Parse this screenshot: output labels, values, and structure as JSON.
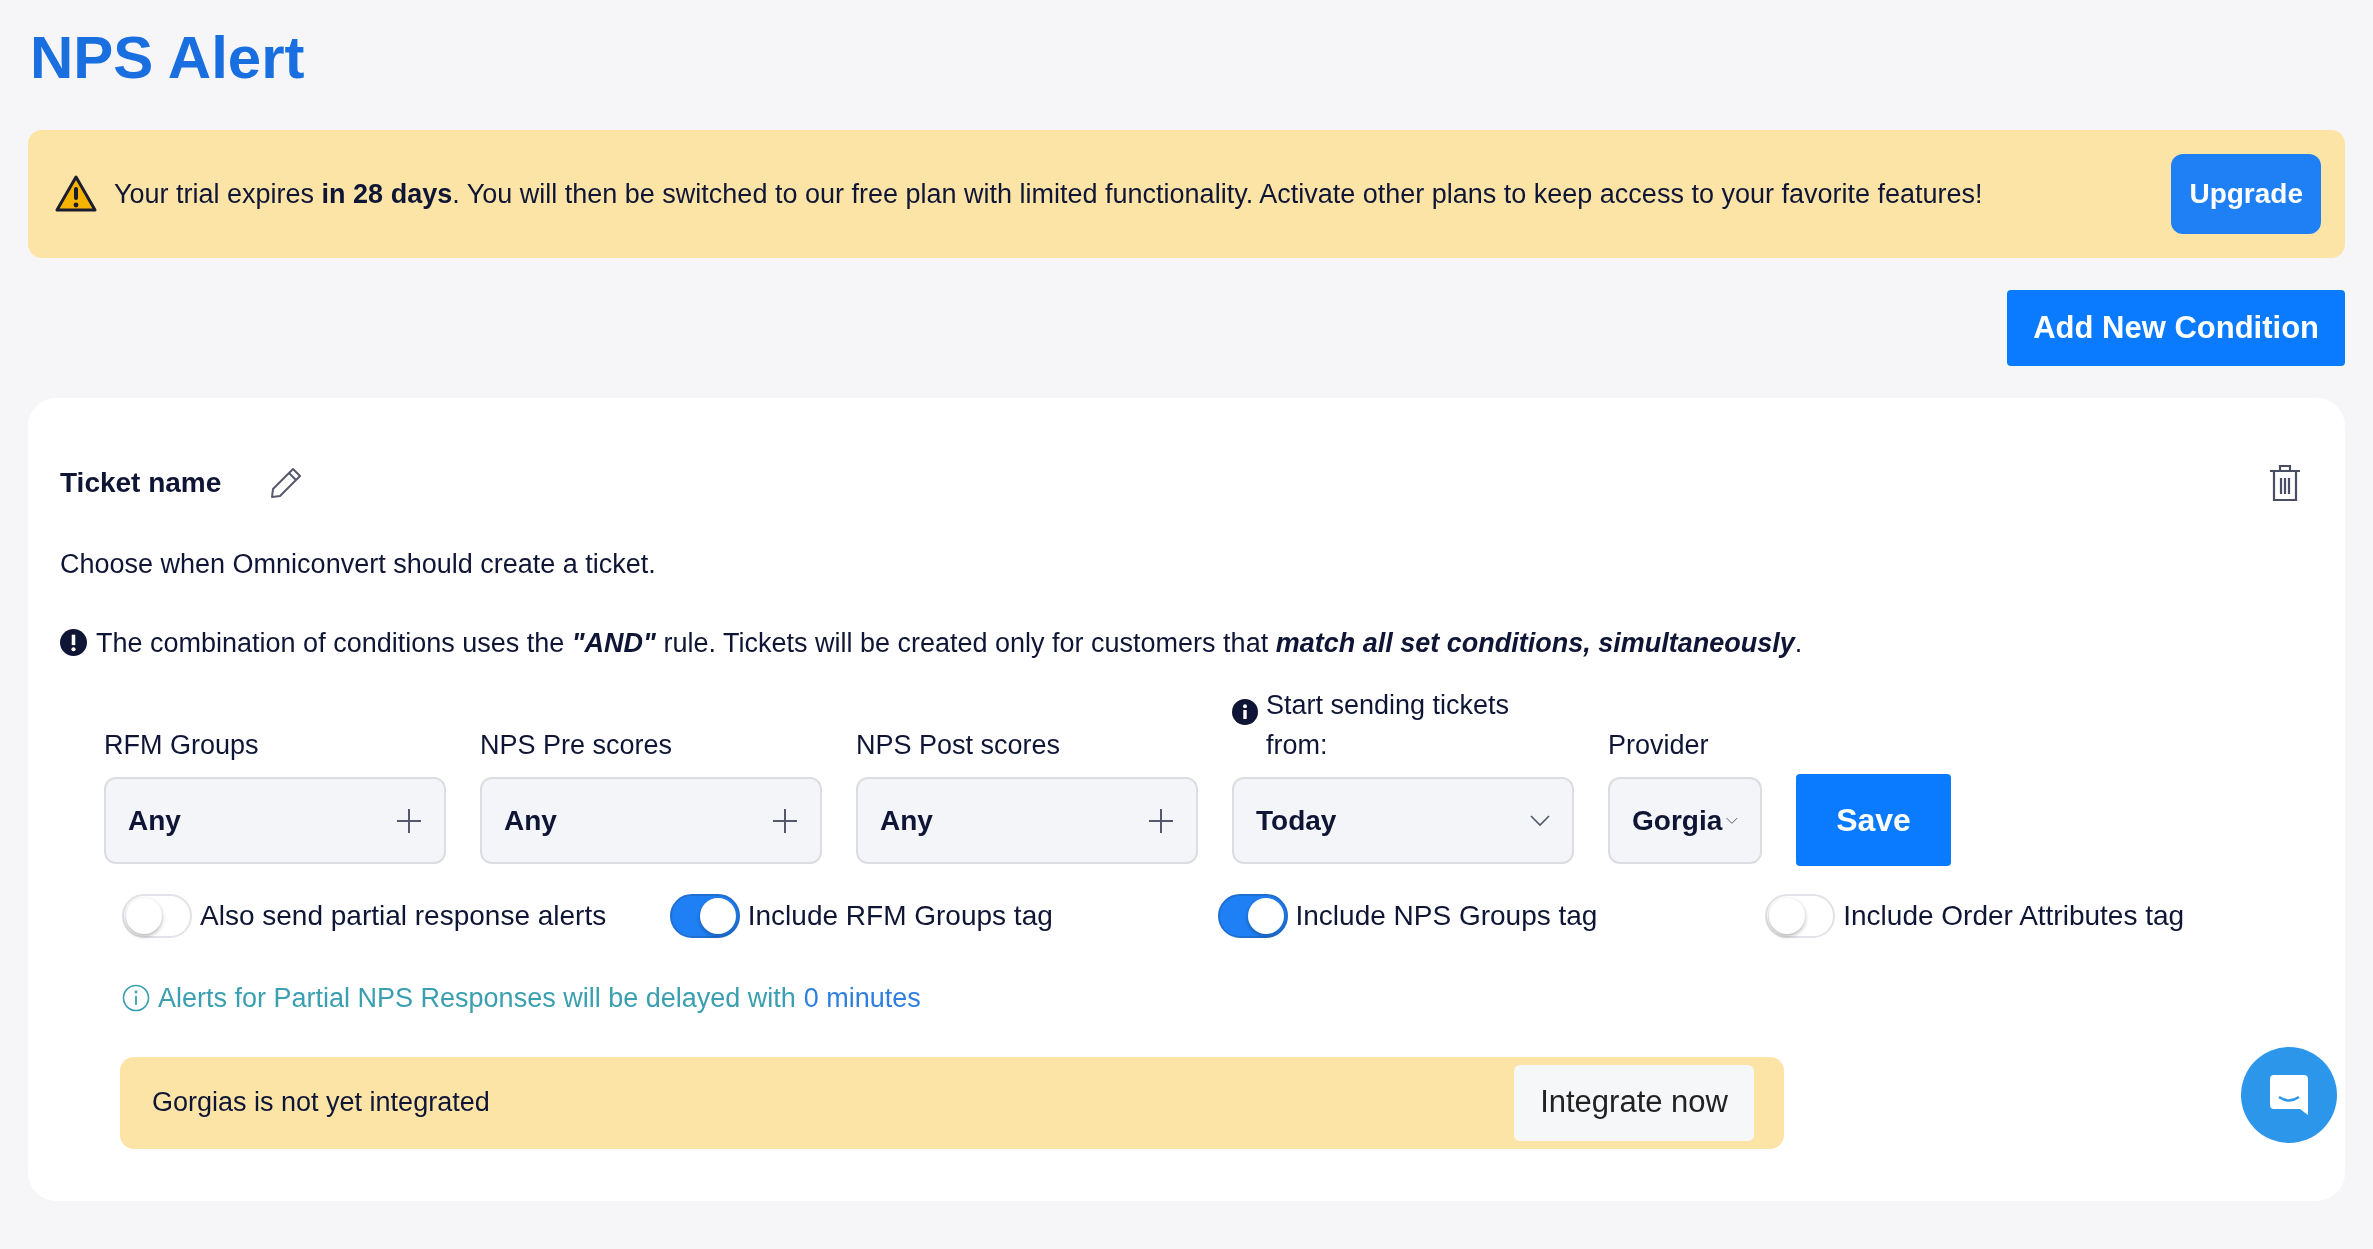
{
  "page_title": "NPS Alert",
  "trial_banner": {
    "message": "Your trial expires **in 28 days**. You will then be switched to our free plan with limited functionality. Activate other plans to keep access to your favorite features!",
    "button": "Upgrade"
  },
  "add_button": "Add New Condition",
  "card": {
    "ticket_name": "Ticket name",
    "description": "Choose when Omniconvert should create a ticket.",
    "rule_note": "The combination of conditions uses the **\"AND\"** rule. Tickets will be created only for customers that **match all set conditions, simultaneously**.",
    "fields": [
      {
        "kind": "multiselect",
        "label": "RFM Groups",
        "value": "Any"
      },
      {
        "kind": "multiselect",
        "label": "NPS Pre scores",
        "value": "Any"
      },
      {
        "kind": "multiselect",
        "label": "NPS Post scores",
        "value": "Any"
      },
      {
        "kind": "dropdown",
        "label": "Start sending tickets from:",
        "info_icon": true,
        "value": "Today"
      },
      {
        "kind": "narrow_dropdown",
        "label": "Provider",
        "value": "Gorgia"
      }
    ],
    "save_button": "Save",
    "toggles": [
      {
        "label": "Also send partial response alerts",
        "on": false
      },
      {
        "label": "Include RFM Groups tag",
        "on": true
      },
      {
        "label": "Include NPS Groups tag",
        "on": true
      },
      {
        "label": "Include Order Attributes tag",
        "on": false
      }
    ],
    "delay_note": {
      "text": "Alerts for Partial NPS Responses will be delayed with",
      "link": "0 minutes"
    },
    "integration_bar": {
      "message": "Gorgias is not yet integrated",
      "button": "Integrate now"
    }
  }
}
